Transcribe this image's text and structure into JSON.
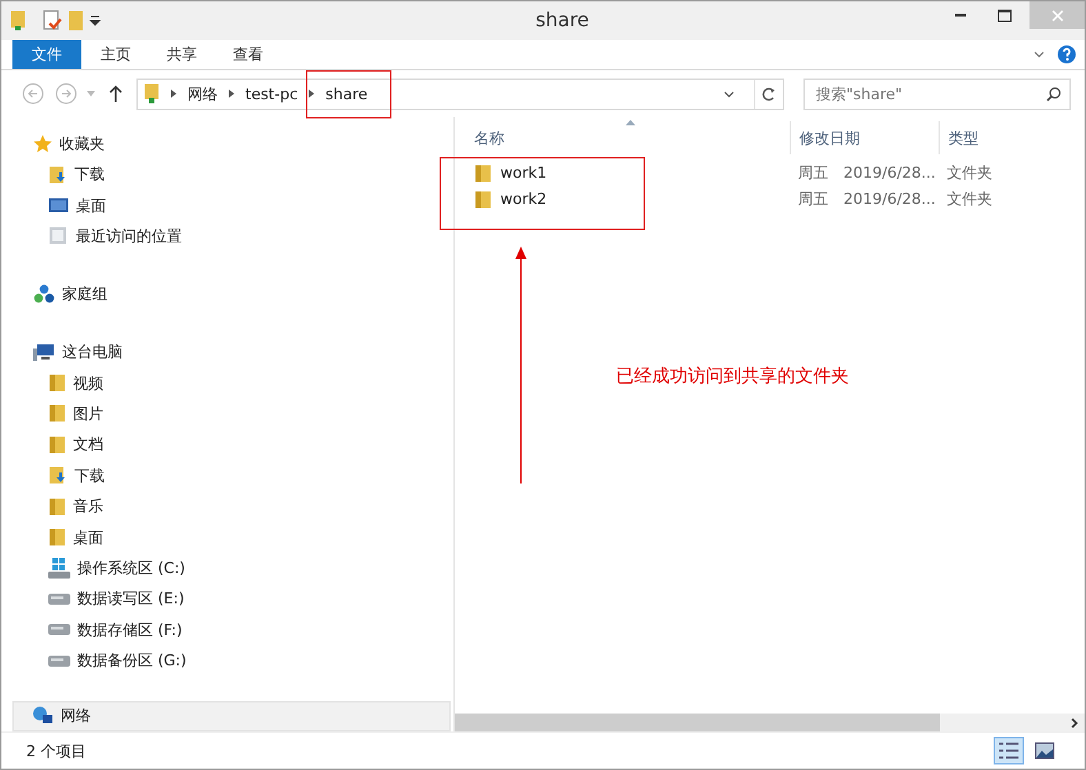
{
  "window": {
    "title": "share"
  },
  "ribbon_tabs": [
    {
      "label": "文件",
      "kind": "file"
    },
    {
      "label": "主页",
      "kind": "tab"
    },
    {
      "label": "共享",
      "kind": "tab"
    },
    {
      "label": "查看",
      "kind": "tab"
    }
  ],
  "address": {
    "crumbs": [
      "网络",
      "test-pc",
      "share"
    ]
  },
  "search": {
    "placeholder": "搜索\"share\""
  },
  "nav": [
    {
      "label": "收藏夹",
      "selected": false,
      "children": [
        {
          "label": "下载",
          "selected": false
        },
        {
          "label": "桌面",
          "selected": false
        },
        {
          "label": "最近访问的位置",
          "selected": false
        }
      ]
    },
    {
      "label": "家庭组",
      "selected": false
    },
    {
      "label": "这台电脑",
      "selected": false,
      "children": [
        {
          "label": "视频",
          "selected": false
        },
        {
          "label": "图片",
          "selected": false
        },
        {
          "label": "文档",
          "selected": false
        },
        {
          "label": "下载",
          "selected": false
        },
        {
          "label": "音乐",
          "selected": false
        },
        {
          "label": "桌面",
          "selected": false
        },
        {
          "label": "操作系统区 (C:)",
          "selected": false
        },
        {
          "label": "数据读写区 (E:)",
          "selected": false
        },
        {
          "label": "数据存储区 (F:)",
          "selected": false
        },
        {
          "label": "数据备份区 (G:)",
          "selected": false
        }
      ]
    },
    {
      "label": "网络",
      "selected": true
    }
  ],
  "table": {
    "columns": [
      "名称",
      "修改日期",
      "类型"
    ],
    "rows": [
      {
        "name": "work1",
        "date": "周五　2019/6/28...",
        "type": "文件夹"
      },
      {
        "name": "work2",
        "date": "周五　2019/6/28...",
        "type": "文件夹"
      }
    ]
  },
  "annotation": {
    "text": "已经成功访问到共享的文件夹"
  },
  "status_bar": {
    "count": "2 个项目",
    "views": [
      {
        "kind": "details",
        "selected": true
      },
      {
        "kind": "thumbnails",
        "selected": false
      }
    ]
  }
}
